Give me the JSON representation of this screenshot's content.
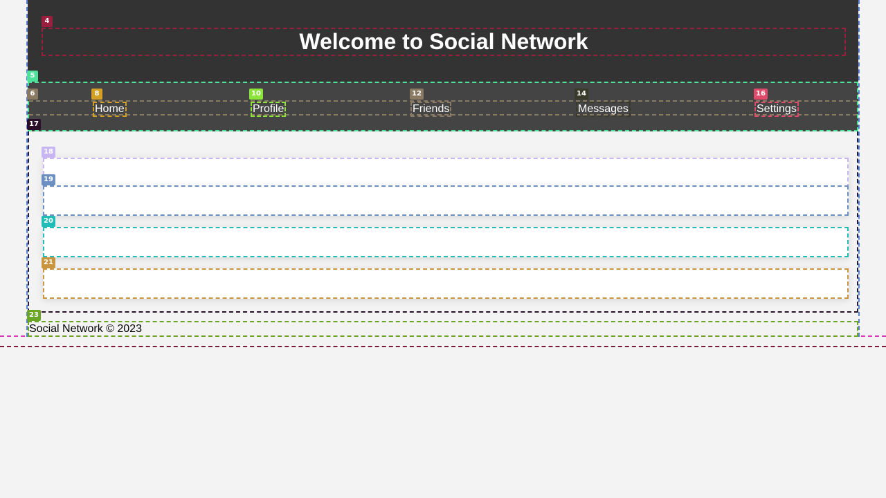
{
  "header": {
    "title": "Welcome to Social Network"
  },
  "nav": {
    "items": [
      {
        "label": "Home"
      },
      {
        "label": "Profile"
      },
      {
        "label": "Friends"
      },
      {
        "label": "Messages"
      },
      {
        "label": "Settings"
      }
    ]
  },
  "footer": {
    "text": "Social Network © 2023"
  },
  "badges": {
    "title": "4",
    "nav": "5",
    "nav_list": "6",
    "home": "8",
    "profile": "10",
    "friends": "12",
    "messages": "14",
    "settings": "16",
    "main": "17",
    "post1": "18",
    "post2": "19",
    "post3": "20",
    "post4": "21",
    "footer": "23"
  },
  "colors": {
    "page_bg": "#f3f3f3",
    "header_bg": "#333333",
    "nav_bg": "#444444",
    "post_bg": "#ffffff"
  }
}
